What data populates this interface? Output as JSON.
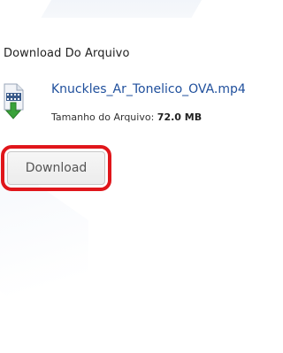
{
  "section": {
    "title": "Download Do Arquivo"
  },
  "file": {
    "icon": "video-file-download-icon",
    "name": "Knuckles_Ar_Tonelico_OVA.mp4",
    "size_label": "Tamanho do Arquivo:",
    "size_value": "72.0 MB"
  },
  "actions": {
    "download_label": "Download",
    "highlight_color": "#e0161b"
  },
  "colors": {
    "link": "#1f4f9c",
    "icon_arrow": "#3aa23a"
  }
}
